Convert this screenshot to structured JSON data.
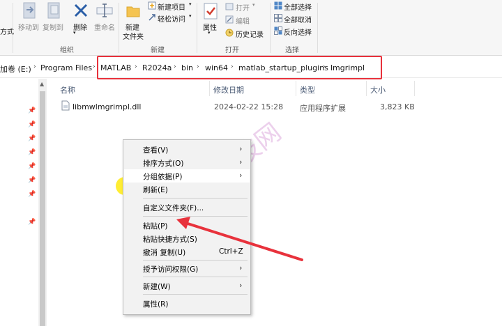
{
  "ribbon": {
    "partial_left": "方式",
    "organize": {
      "move_to": "移动到",
      "copy_to": "复制到",
      "delete": "删除",
      "rename": "重命名",
      "group": "组织"
    },
    "new": {
      "new_item": "新建项目",
      "easy_access": "轻松访问",
      "new_folder_line1": "新建",
      "new_folder_line2": "文件夹",
      "group": "新建"
    },
    "open": {
      "properties": "属性",
      "open": "打开",
      "edit": "编辑",
      "history": "历史记录",
      "group": "打开"
    },
    "select": {
      "select_all": "全部选择",
      "select_none": "全部取消",
      "invert": "反向选择",
      "group": "选择"
    }
  },
  "address": {
    "crumbs": [
      "加卷 (E:)",
      "Program Files",
      "MATLAB",
      "R2024a",
      "bin",
      "win64",
      "matlab_startup_plugins",
      "lmgrimpl"
    ]
  },
  "columns": {
    "name": "名称",
    "date": "修改日期",
    "type": "类型",
    "size": "大小"
  },
  "files": [
    {
      "name": "libmwlmgrimpl.dll",
      "date": "2024-02-22 15:28",
      "type": "应用程序扩展",
      "size": "3,823 KB"
    }
  ],
  "menu": {
    "view": "查看(V)",
    "sort": "排序方式(O)",
    "group_by": "分组依据(P)",
    "refresh": "刷新(E)",
    "customize": "自定义文件夹(F)...",
    "paste": "粘贴(P)",
    "paste_shortcut": "粘贴快捷方式(S)",
    "undo": "撤消 复制(U)",
    "undo_shortcut": "Ctrl+Z",
    "grant_access": "授予访问权限(G)",
    "new": "新建(W)",
    "properties": "属性(R)"
  },
  "watermark": "锦技网",
  "colors": {
    "highlight_box": "#e8323c",
    "arrow": "#e8323c",
    "cursor_highlight": "#ffe800"
  }
}
